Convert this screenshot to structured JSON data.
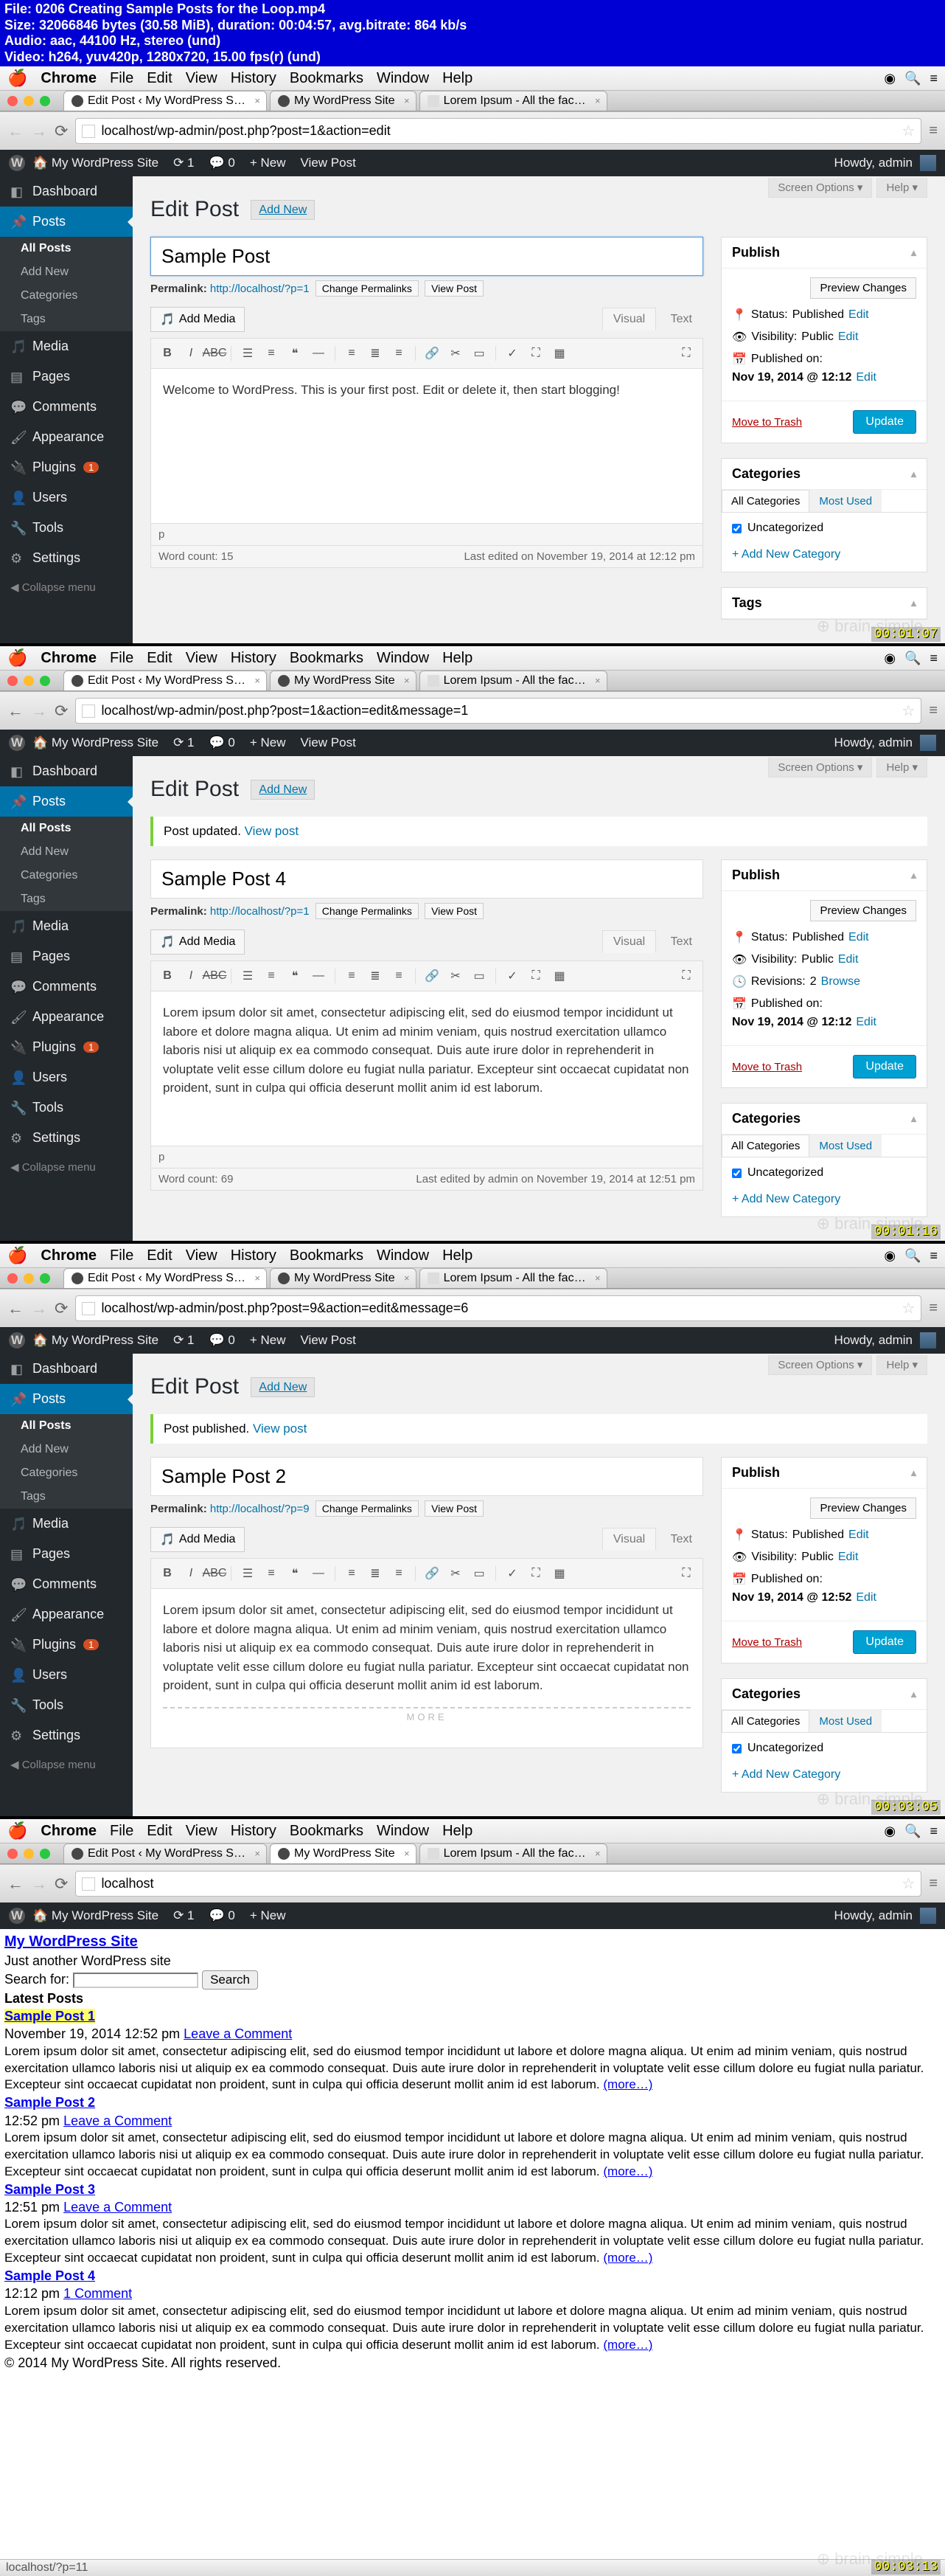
{
  "file_info": {
    "l1": "File: 0206 Creating Sample Posts for the Loop.mp4",
    "l2": "Size: 32066846 bytes (30.58 MiB), duration: 00:04:57, avg.bitrate: 864 kb/s",
    "l3": "Audio: aac, 44100 Hz, stereo (und)",
    "l4": "Video: h264, yuv420p, 1280x720, 15.00 fps(r) (und)"
  },
  "mac_menu": {
    "app": "Chrome",
    "items": [
      "File",
      "Edit",
      "View",
      "History",
      "Bookmarks",
      "Window",
      "Help"
    ]
  },
  "browser": {
    "tabs": [
      {
        "label": "Edit Post ‹ My WordPress S…",
        "active": true
      },
      {
        "label": "My WordPress Site",
        "active": false
      },
      {
        "label": "Lorem Ipsum - All the fac…",
        "active": false
      }
    ]
  },
  "adminbar": {
    "site": "My WordPress Site",
    "comments": "0",
    "new": "New",
    "viewpost": "View Post",
    "howdy": "Howdy, admin"
  },
  "sidebar": {
    "items": [
      "Dashboard",
      "Posts",
      "Media",
      "Pages",
      "Comments",
      "Appearance",
      "Plugins",
      "Users",
      "Tools",
      "Settings"
    ],
    "plugins_badge": "1",
    "submenu": [
      "All Posts",
      "Add New",
      "Categories",
      "Tags"
    ],
    "collapse": "Collapse menu"
  },
  "screen_meta": {
    "options": "Screen Options ▾",
    "help": "Help ▾"
  },
  "heading": {
    "title": "Edit Post",
    "add_new": "Add New"
  },
  "editor_tabs": {
    "visual": "Visual",
    "text": "Text"
  },
  "media_btn": "Add Media",
  "permalink_label": "Permalink:",
  "btns": {
    "change_perm": "Change Permalinks",
    "view_post": "View Post",
    "preview": "Preview Changes",
    "update": "Update",
    "trash": "Move to Trash"
  },
  "publish_box": {
    "title": "Publish",
    "status_label": "Status:",
    "status_val": "Published",
    "edit": "Edit",
    "vis_label": "Visibility:",
    "vis_val": "Public",
    "rev_label": "Revisions:",
    "browse": "Browse",
    "pub_label": "Published on:"
  },
  "cat_box": {
    "title": "Categories",
    "all": "All Categories",
    "most": "Most Used",
    "uncat": "Uncategorized",
    "add": "+ Add New Category"
  },
  "tags_box": {
    "title": "Tags"
  },
  "frames": [
    {
      "url": "localhost/wp-admin/post.php?post=1&action=edit",
      "timecode": "00:01:07",
      "notice": null,
      "title": "Sample Post",
      "title_focused": true,
      "permalink": "http://localhost/?p=1",
      "body": "Welcome to WordPress. This is your first post. Edit or delete it, then start blogging!",
      "more": false,
      "path": "p",
      "wordcount": "Word count: 15",
      "lastedit": "Last edited on November 19, 2014 at 12:12 pm",
      "revisions": null,
      "pub_on": "Nov 19, 2014 @ 12:12",
      "show_tags": true
    },
    {
      "url": "localhost/wp-admin/post.php?post=1&action=edit&message=1",
      "timecode": "00:01:16",
      "notice": "Post updated.",
      "notice_link": "View post",
      "title": "Sample Post 4",
      "title_focused": false,
      "permalink": "http://localhost/?p=1",
      "body": "Lorem ipsum dolor sit amet, consectetur adipiscing elit, sed do eiusmod tempor incididunt ut labore et dolore magna aliqua. Ut enim ad minim veniam, quis nostrud exercitation ullamco laboris nisi ut aliquip ex ea commodo consequat. Duis aute irure dolor in reprehenderit in voluptate velit esse cillum dolore eu fugiat nulla pariatur. Excepteur sint occaecat cupidatat non proident, sunt in culpa qui officia deserunt mollit anim id est laborum.",
      "more": false,
      "path": "p",
      "wordcount": "Word count: 69",
      "lastedit": "Last edited by admin on November 19, 2014 at 12:51 pm",
      "revisions": "2",
      "pub_on": "Nov 19, 2014 @ 12:12",
      "show_tags": false
    },
    {
      "url": "localhost/wp-admin/post.php?post=9&action=edit&message=6",
      "timecode": "00:03:05",
      "notice": "Post published.",
      "notice_link": "View post",
      "title": "Sample Post 2",
      "title_focused": false,
      "permalink": "http://localhost/?p=9",
      "body": "Lorem ipsum dolor sit amet, consectetur adipiscing elit, sed do eiusmod tempor incididunt ut labore et dolore magna aliqua. Ut enim ad minim veniam, quis nostrud exercitation ullamco laboris nisi ut aliquip ex ea commodo consequat. Duis aute irure dolor in reprehenderit in voluptate velit esse cillum dolore eu fugiat nulla pariatur. Excepteur sint occaecat cupidatat non proident, sunt in culpa qui officia deserunt mollit anim id est laborum.",
      "more": true,
      "more_label": "MORE",
      "path": null,
      "wordcount": null,
      "lastedit": null,
      "revisions": null,
      "pub_on": "Nov 19, 2014 @ 12:52",
      "show_tags": false
    }
  ],
  "frontend": {
    "url": "localhost",
    "timecode": "00:03:13",
    "adminbar_items": [
      "My WordPress Site",
      "1",
      "0",
      "New"
    ],
    "site_title": "My WordPress Site",
    "tagline": "Just another WordPress site",
    "search_label": "Search for:",
    "search_btn": "Search",
    "latest": "Latest Posts",
    "more_link": "(more…)",
    "leave_comment": "Leave a Comment",
    "one_comment": "1 Comment",
    "copyright": "© 2014 My WordPress Site. All rights reserved.",
    "status_url": "localhost/?p=11",
    "posts": [
      {
        "title": "Sample Post 1",
        "hl": true,
        "meta": "November 19, 2014 12:52 pm",
        "excerpt": "Lorem ipsum dolor sit amet, consectetur adipiscing elit, sed do eiusmod tempor incididunt ut labore et dolore magna aliqua. Ut enim ad minim veniam, quis nostrud exercitation ullamco laboris nisi ut aliquip ex ea commodo consequat. Duis aute irure dolor in reprehenderit in voluptate velit esse cillum dolore eu fugiat nulla pariatur. Excepteur sint occaecat cupidatat non proident, sunt in culpa qui officia deserunt mollit anim id est laborum."
      },
      {
        "title": "Sample Post 2",
        "hl": false,
        "meta": "12:52 pm",
        "excerpt": "Lorem ipsum dolor sit amet, consectetur adipiscing elit, sed do eiusmod tempor incididunt ut labore et dolore magna aliqua. Ut enim ad minim veniam, quis nostrud exercitation ullamco laboris nisi ut aliquip ex ea commodo consequat. Duis aute irure dolor in reprehenderit in voluptate velit esse cillum dolore eu fugiat nulla pariatur. Excepteur sint occaecat cupidatat non proident, sunt in culpa qui officia deserunt mollit anim id est laborum."
      },
      {
        "title": "Sample Post 3",
        "hl": false,
        "meta": "12:51 pm",
        "excerpt": "Lorem ipsum dolor sit amet, consectetur adipiscing elit, sed do eiusmod tempor incididunt ut labore et dolore magna aliqua. Ut enim ad minim veniam, quis nostrud exercitation ullamco laboris nisi ut aliquip ex ea commodo consequat. Duis aute irure dolor in reprehenderit in voluptate velit esse cillum dolore eu fugiat nulla pariatur. Excepteur sint occaecat cupidatat non proident, sunt in culpa qui officia deserunt mollit anim id est laborum."
      },
      {
        "title": "Sample Post 4",
        "hl": false,
        "meta": "12:12 pm",
        "comment": "1",
        "excerpt": "Lorem ipsum dolor sit amet, consectetur adipiscing elit, sed do eiusmod tempor incididunt ut labore et dolore magna aliqua. Ut enim ad minim veniam, quis nostrud exercitation ullamco laboris nisi ut aliquip ex ea commodo consequat. Duis aute irure dolor in reprehenderit in voluptate velit esse cillum dolore eu fugiat nulla pariatur. Excepteur sint occaecat cupidatat non proident, sunt in culpa qui officia deserunt mollit anim id est laborum."
      }
    ]
  }
}
